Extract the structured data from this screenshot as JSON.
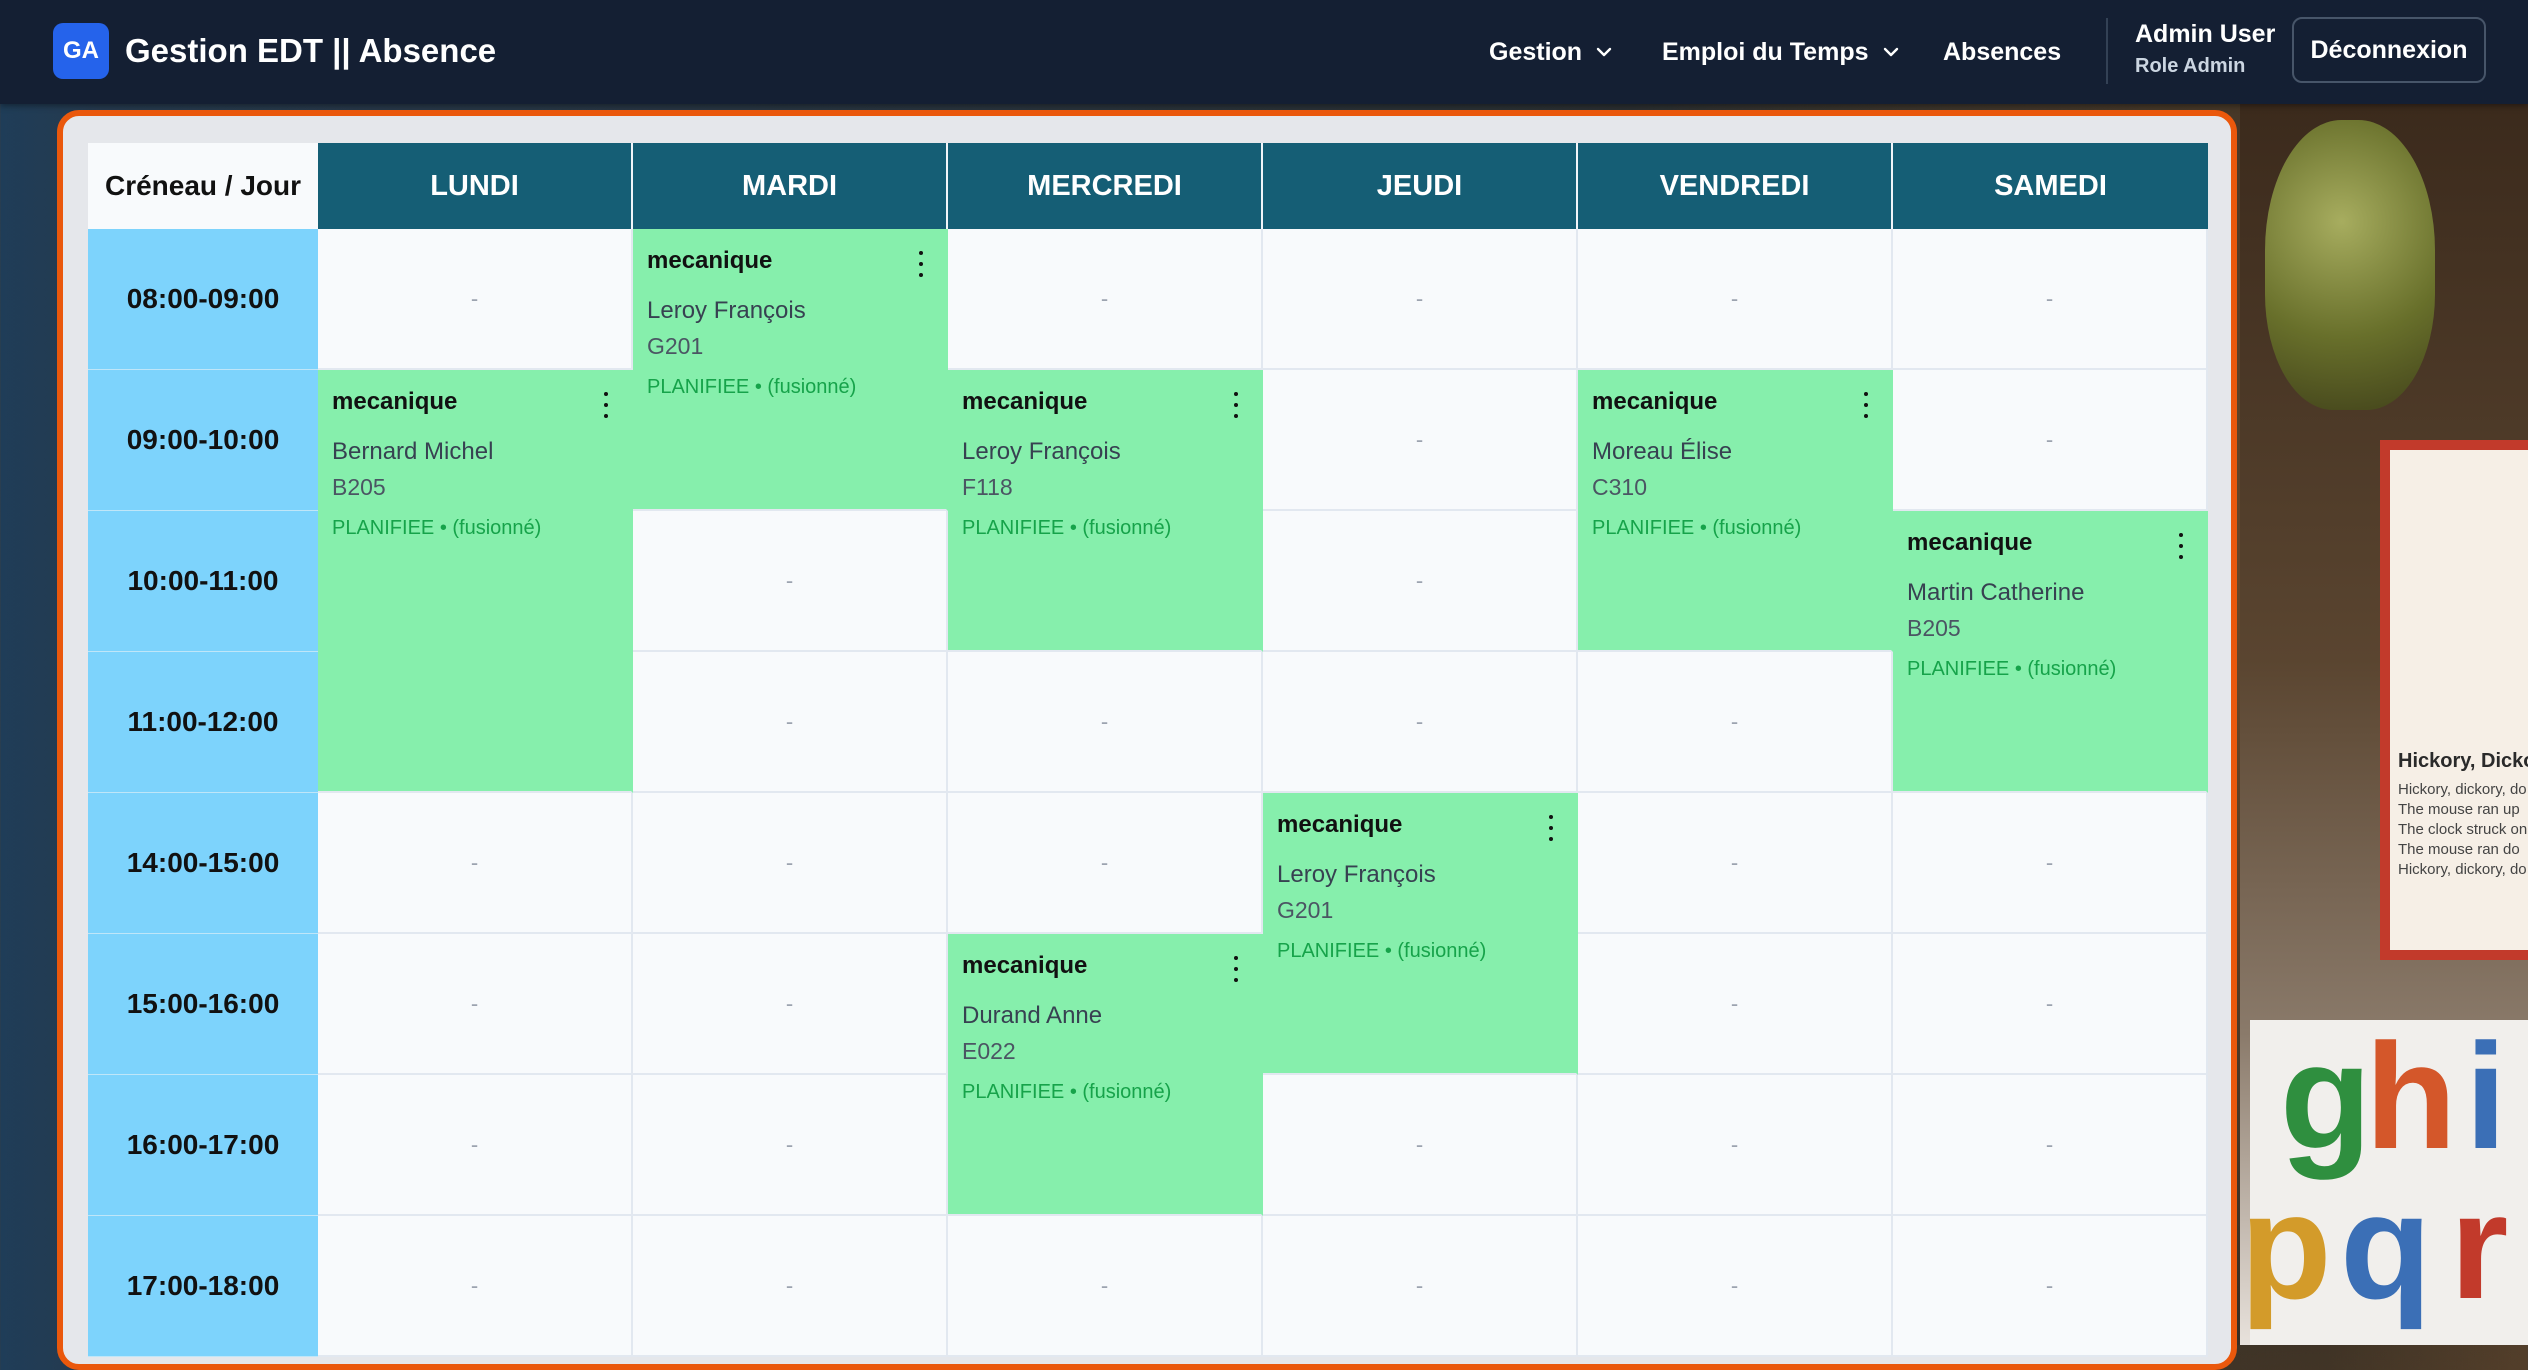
{
  "brand": {
    "logo_text": "GA",
    "title": "Gestion EDT || Absence"
  },
  "nav": {
    "gestion": "Gestion",
    "emploi": "Emploi du Temps",
    "absences": "Absences"
  },
  "user": {
    "name": "Admin User",
    "role": "Role Admin"
  },
  "logout_label": "Déconnexion",
  "timetable": {
    "corner": "Créneau / Jour",
    "days": [
      "LUNDI",
      "MARDI",
      "MERCREDI",
      "JEUDI",
      "VENDREDI",
      "SAMEDI"
    ],
    "slots": [
      "08:00-09:00",
      "09:00-10:00",
      "10:00-11:00",
      "11:00-12:00",
      "14:00-15:00",
      "15:00-16:00",
      "16:00-17:00",
      "17:00-18:00"
    ],
    "empty": "-",
    "courses": [
      {
        "title": "mecanique",
        "teacher": "Bernard Michel",
        "room": "B205",
        "status": "PLANIFIEE • (fusionné)"
      },
      {
        "title": "mecanique",
        "teacher": "Leroy François",
        "room": "G201",
        "status": "PLANIFIEE • (fusionné)"
      },
      {
        "title": "mecanique",
        "teacher": "Leroy François",
        "room": "F118",
        "status": "PLANIFIEE • (fusionné)"
      },
      {
        "title": "mecanique",
        "teacher": "Durand Anne",
        "room": "E022",
        "status": "PLANIFIEE • (fusionné)"
      },
      {
        "title": "mecanique",
        "teacher": "Leroy François",
        "room": "G201",
        "status": "PLANIFIEE • (fusionné)"
      },
      {
        "title": "mecanique",
        "teacher": "Moreau Élise",
        "room": "C310",
        "status": "PLANIFIEE • (fusionné)"
      },
      {
        "title": "mecanique",
        "teacher": "Martin Catherine",
        "room": "B205",
        "status": "PLANIFIEE • (fusionné)"
      }
    ]
  },
  "background_poster": {
    "title": "Hickory, Dickory",
    "lines": [
      "Hickory, dickory, do",
      "The mouse ran up",
      "The clock struck on",
      "The mouse ran do",
      "Hickory, dickory, do"
    ]
  },
  "background_letters": [
    "g",
    "h",
    "i",
    "p",
    "q",
    "r"
  ],
  "colors": {
    "header_bg": "#141f33",
    "day_header": "#155e75",
    "slot_bg": "#7dd3fc",
    "course_bg": "#86efac",
    "status_text": "#16a34a",
    "card_border": "#ea580c",
    "logo_bg": "#2563eb"
  }
}
